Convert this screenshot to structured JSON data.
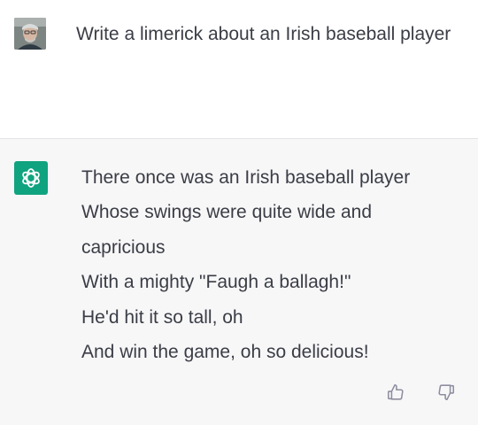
{
  "user_message": {
    "avatar": "user-avatar-photo",
    "text": "Write a limerick about an Irish baseball player"
  },
  "assistant_message": {
    "icon": "openai-logo-icon",
    "brand_color": "#10a37f",
    "lines": [
      "There once was an Irish baseball player",
      "Whose swings were quite wide and",
      "capricious",
      "With a mighty \"Faugh a ballagh!\"",
      "He'd hit it so tall, oh",
      "And win the game, oh so delicious!"
    ],
    "feedback": {
      "up_icon": "thumbs-up-icon",
      "down_icon": "thumbs-down-icon"
    }
  },
  "colors": {
    "user_bg": "#ffffff",
    "assistant_bg": "#f7f7f8",
    "text": "#3b3d46",
    "icon_gray": "#8e8ea0"
  }
}
